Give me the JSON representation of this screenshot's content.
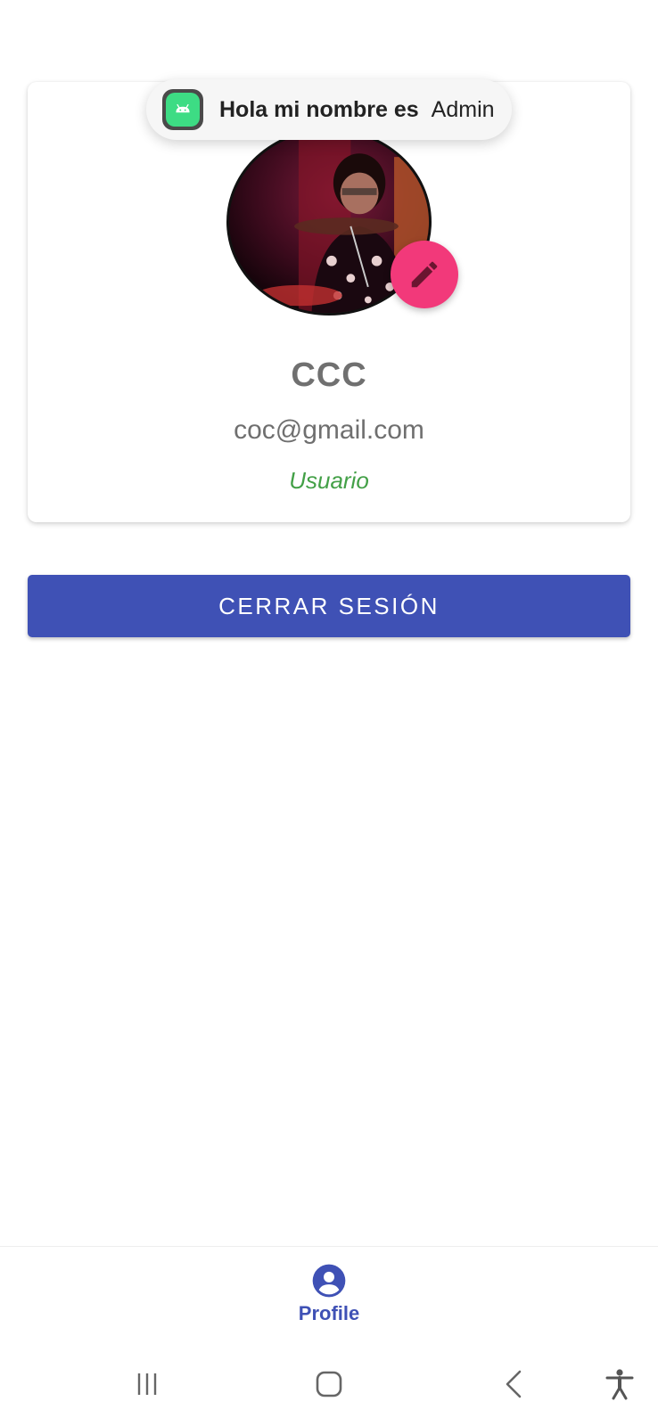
{
  "toast": {
    "title": "Hola mi nombre es",
    "value": "Admin",
    "icon": "android-app-icon"
  },
  "profile": {
    "name": "CCC",
    "email": "coc@gmail.com",
    "role": "Usuario",
    "avatar": "profile-photo",
    "edit_icon": "pencil-icon"
  },
  "actions": {
    "logout_label": "CERRAR SESIÓN"
  },
  "bottom_nav": {
    "items": [
      {
        "label": "Profile",
        "icon": "account-circle-icon"
      }
    ]
  },
  "system_nav": {
    "items": [
      "recents-icon",
      "home-icon",
      "back-icon",
      "accessibility-icon"
    ]
  },
  "colors": {
    "primary": "#3f51b5",
    "accent": "#f2397a",
    "role": "#43a047",
    "text_secondary": "#707070"
  }
}
